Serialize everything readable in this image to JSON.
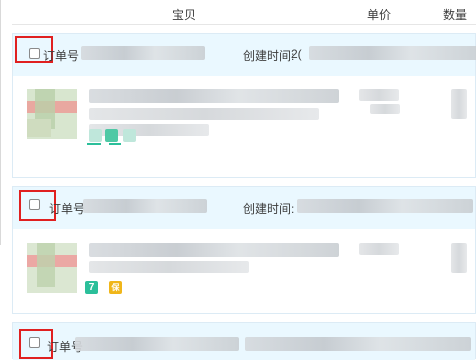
{
  "table_header": {
    "product": "宝贝",
    "price": "单价",
    "quantity": "数量"
  },
  "orders": [
    {
      "order_no_label": "订单号",
      "created_label": "创建时间:",
      "created_value": "2("
    },
    {
      "order_no_label": "订单号",
      "created_label": "创建时间:",
      "created_value": ""
    },
    {
      "order_no_label": "订单号",
      "created_label": "",
      "created_value": ""
    }
  ],
  "badges": {
    "seven_day_return": "7",
    "guarantee": "保"
  },
  "colors": {
    "order_header_bg": "#eaf8ff",
    "highlight_border": "#e02020",
    "badge_green": "#2bbf9a",
    "badge_yellow": "#f0b61a"
  }
}
